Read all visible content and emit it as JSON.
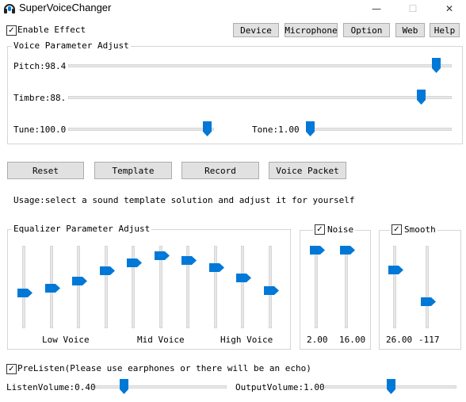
{
  "window": {
    "title": "SuperVoiceChanger",
    "minimize_glyph": "—",
    "maximize_glyph": "☐",
    "close_glyph": "✕"
  },
  "enable_effect": {
    "label": "Enable Effect",
    "checked": true
  },
  "top_buttons": [
    "Device",
    "Microphone",
    "Option",
    "Web",
    "Help"
  ],
  "voice_params": {
    "legend": "Voice Parameter Adjust",
    "pitch_label": "Pitch:98.4",
    "timbre_label": "Timbre:88.",
    "tune_label": "Tune:100.0",
    "tone_label": "Tone:1.00",
    "pitch_level": 0.97,
    "timbre_level": 0.93,
    "tune_level": 0.98,
    "tone_level": 0.0
  },
  "action_buttons": [
    "Reset",
    "Template",
    "Record",
    "Voice Packet"
  ],
  "usage_text": "Usage:select a sound template solution and adjust it for yourself",
  "equalizer": {
    "legend": "Equalizer Parameter Adjust",
    "band_levels": [
      0.42,
      0.48,
      0.58,
      0.72,
      0.83,
      0.93,
      0.86,
      0.76,
      0.62,
      0.45
    ],
    "low_label": "Low Voice",
    "mid_label": "Mid Voice",
    "high_label": "High Voice"
  },
  "noise": {
    "label": "Noise",
    "checked": true,
    "slider1_value": "2.00",
    "slider2_value": "16.00",
    "slider1_level": 1.0,
    "slider2_level": 1.0
  },
  "smooth": {
    "label": "Smooth",
    "checked": true,
    "slider1_value": "26.00",
    "slider2_value": "-117",
    "slider1_level": 0.73,
    "slider2_level": 0.3
  },
  "prelisten": {
    "label": "PreListen(Please use earphones or there will be an echo)",
    "checked": true
  },
  "listen_volume": {
    "label": "ListenVolume:0.40",
    "level": 0.2
  },
  "output_volume": {
    "label": "OutputVolume:1.00",
    "level": 0.5
  },
  "colors": {
    "accent": "#0078d7",
    "track": "#e7e7e7",
    "group_border": "#d5d5d5",
    "button_bg": "#e1e1e1"
  },
  "icons": {
    "app": "headphones-icon",
    "check": "checkmark-icon"
  }
}
